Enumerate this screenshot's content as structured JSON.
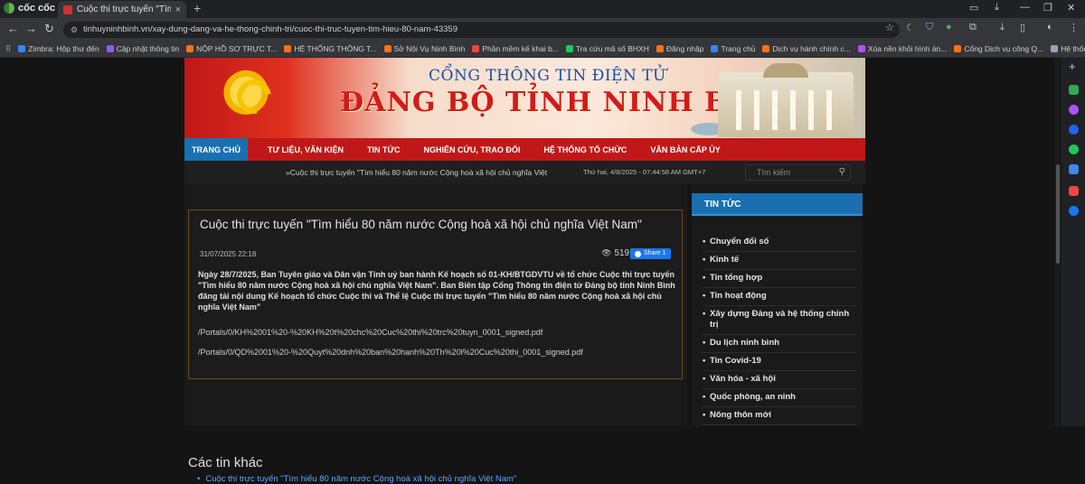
{
  "browser": {
    "brand": "cốc cốc",
    "tab_title": "Cuộc thi trực tuyến \"Tìm hiể",
    "url": "tinhuyninhbinh.vn/xay-dung-dang-va-he-thong-chinh-tri/cuoc-thi-truc-tuyen-tim-hieu-80-nam-43359",
    "bookmarks": [
      {
        "label": "Zimbra: Hộp thư đến",
        "color": "#3b82f6"
      },
      {
        "label": "Cập nhật thông tin",
        "color": "#8b5cf6"
      },
      {
        "label": "NỘP HỒ SƠ TRỰC T...",
        "color": "#f97316"
      },
      {
        "label": "HỆ THỐNG THÔNG T...",
        "color": "#f97316"
      },
      {
        "label": "Sở Nội Vụ Ninh Bình",
        "color": "#f97316"
      },
      {
        "label": "Phần mềm kế khai b...",
        "color": "#ef4444"
      },
      {
        "label": "Tra cứu mã số BHXH",
        "color": "#22c55e"
      },
      {
        "label": "Đăng nhập",
        "color": "#f97316"
      },
      {
        "label": "Trang chủ",
        "color": "#3b82f6"
      },
      {
        "label": "Dịch vụ hành chính c...",
        "color": "#f97316"
      },
      {
        "label": "Xóa nền khỏi hình ản...",
        "color": "#a855f7"
      },
      {
        "label": "Cổng Dịch vụ công Q...",
        "color": "#f97316"
      },
      {
        "label": "Hệ thống đăng ký, q...",
        "color": "#9ca3af"
      }
    ]
  },
  "site": {
    "portal_sub": "CỔNG THÔNG TIN ĐIỆN TỬ",
    "portal_name": "ĐẢNG BỘ TỈNH NINH BÌNH",
    "nav": [
      "TRANG CHỦ",
      "TƯ LIỆU, VĂN KIỆN",
      "TIN TỨC",
      "NGHIÊN CỨU, TRAO ĐỔI",
      "HỆ THỐNG TỔ CHỨC",
      "VĂN BẢN CẤP ỦY"
    ],
    "ticker": "»Cuộc thi trực tuyến \"Tìm hiểu 80 năm nước Cộng hoà xã hội chủ nghĩa Việt",
    "date": "Thứ hai, 4/8/2025 - 07:44:58 AM GMT+7",
    "search_placeholder": "Tìm kiếm"
  },
  "article": {
    "title": "Cuộc thi trực tuyến \"Tìm hiểu 80 năm nước Cộng hoà xã hội chủ nghĩa Việt Nam\"",
    "date": "31/07/2025 22:18",
    "views": "519",
    "share_label": "Share 1",
    "body": "Ngày 28/7/2025, Ban Tuyên giáo và Dân vận Tỉnh uỷ ban hành Kế hoạch số 01-KH/BTGDVTU về tổ chức Cuộc thi trực tuyến \"Tìm hiểu 80 năm nước Cộng hoà xã hội chủ nghĩa Việt Nam\". Ban Biên tập Cổng Thông tin điện tử Đảng bộ tỉnh Ninh Bình đăng tải nội dung Kế hoạch tổ chức Cuộc thi và Thể lệ Cuộc thi trực tuyến \"Tìm hiểu 80 năm nước Cộng hoà xã hội chủ nghĩa Việt Nam\"",
    "link1": "/Portals/0/KH%2001%20-%20KH%20t%20chc%20Cuc%20thi%20trc%20tuyn_0001_signed.pdf",
    "link2": "/Portals/0/QD%2001%20-%20Quyt%20dnh%20ban%20hanh%20Th%20l%20Cuc%20thi_0001_signed.pdf"
  },
  "others": {
    "title": "Các tin khác",
    "item": "Cuộc thi trực tuyến \"Tìm hiểu 80 năm nước Cộng hoà xã hội chủ nghĩa Việt Nam\""
  },
  "sidebar": {
    "heading": "TIN TỨC",
    "items": [
      "Chuyển đổi số",
      "Kinh tế",
      "Tin tổng hợp",
      "Tin hoạt động",
      "Xây dựng Đảng và hệ thống chính trị",
      "Du lịch ninh bình",
      "Tin Covid-19",
      "Văn hóa - xã hội",
      "Quốc phòng, an ninh",
      "Nông thôn mới"
    ]
  }
}
